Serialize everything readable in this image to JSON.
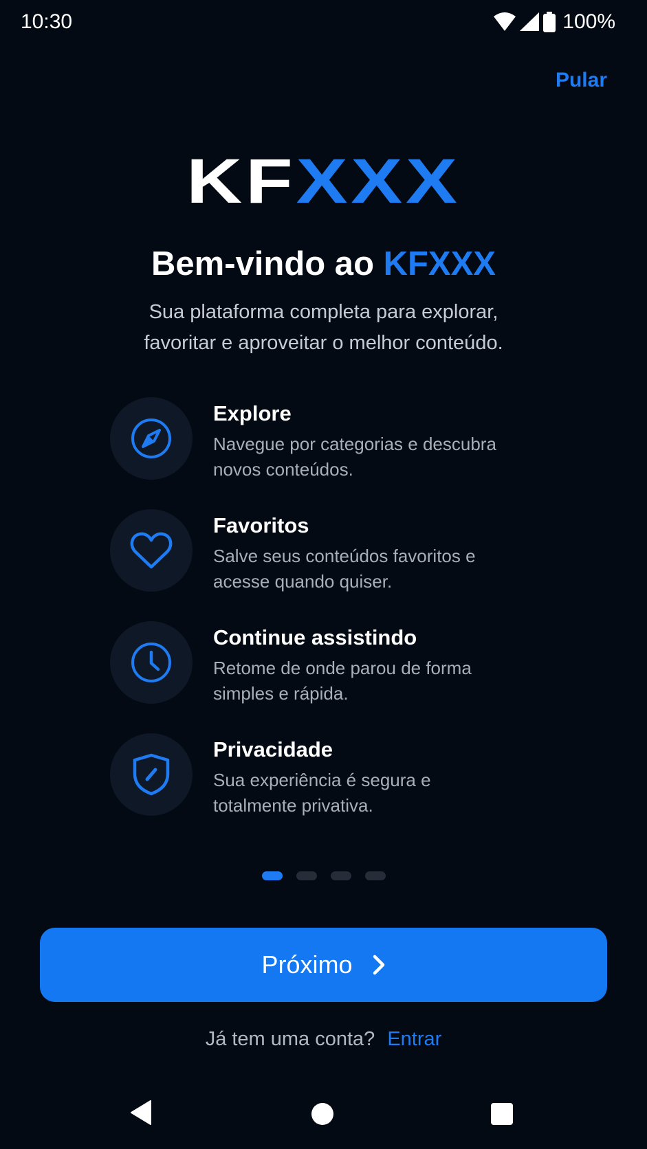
{
  "status_bar": {
    "time": "10:30",
    "battery_percent": "100%",
    "icons": [
      "wifi-icon",
      "signal-icon",
      "battery-icon"
    ]
  },
  "header": {
    "skip_label": "Pular"
  },
  "logo": {
    "part1": "KF",
    "part2": "XXX"
  },
  "headline": {
    "prefix": "Bem-vindo ao ",
    "brand": "KFXXX"
  },
  "subtitle": {
    "line1": "Sua plataforma completa para explorar,",
    "line2": "favoritar e aproveitar o melhor conteúdo."
  },
  "features": [
    {
      "icon": "compass-icon",
      "title": "Explore",
      "desc_line1": "Navegue por categorias e descubra",
      "desc_line2": "novos conteúdos."
    },
    {
      "icon": "heart-icon",
      "title": "Favoritos",
      "desc_line1": "Salve seus conteúdos favoritos e",
      "desc_line2": "acesse quando quiser."
    },
    {
      "icon": "clock-icon",
      "title": "Continue assistindo",
      "desc_line1": "Retome de onde parou de forma",
      "desc_line2": "simples e rápida."
    },
    {
      "icon": "shield-icon",
      "title": "Privacidade",
      "desc_line1": "Sua experiência é segura e",
      "desc_line2": "totalmente privativa."
    }
  ],
  "pagination": {
    "total_pages": 4,
    "current_page": 1
  },
  "primary_button": {
    "label": "Próximo"
  },
  "login_prompt": {
    "question": "Já tem uma conta?",
    "link": "Entrar"
  },
  "colors": {
    "background": "#040A13",
    "accent": "#1E7BF2",
    "button": "#1478F3",
    "icon_circle": "#0F1826",
    "muted_text": "#A9AFBA"
  }
}
